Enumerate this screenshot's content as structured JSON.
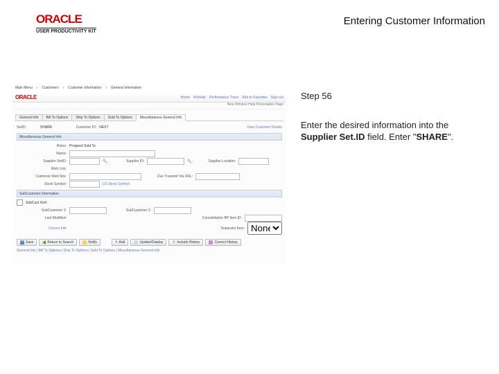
{
  "header": {
    "logo_main": "ORACLE",
    "logo_sub": "USER PRODUCTIVITY KIT",
    "page_title": "Entering Customer Information"
  },
  "instruction": {
    "step": "Step 56",
    "text_1": "Enter the desired information into the ",
    "field": "Supplier Set.ID",
    "text_2": " field. Enter \"",
    "value": "SHARE",
    "text_3": "\"."
  },
  "shot": {
    "breadcrumb": [
      "Main Menu",
      "Customers",
      "Customer Information",
      "General Information"
    ],
    "oracle": "ORACLE",
    "links": [
      "Home",
      "Worklist",
      "Performance Trace",
      "Add to Favorites",
      "Sign out"
    ],
    "subbar": "New Window   Help   Personalize Page",
    "tabs": [
      "General Info",
      "Bill To Options",
      "Ship To Options",
      "Sold To Options",
      "Miscellaneous General Info"
    ],
    "setid": {
      "label": "SetID:",
      "value": "SHARE"
    },
    "custid": {
      "label": "Customer ID:",
      "value": "NEXT"
    },
    "cust_details": "View Customer Details",
    "sect_misc": "Miscellaneous General Info",
    "roles": {
      "label": "Roles:",
      "value": "Prospect  Sold To"
    },
    "name": {
      "label": "Name:"
    },
    "supplier_setid": {
      "label": "Supplier SetID:"
    },
    "supplier_id": {
      "label": "Supplier ID:"
    },
    "supplier_loc": {
      "label": "Supplier Location:"
    },
    "weblink": {
      "label": "Web Link:"
    },
    "cust_website": {
      "label": "Customer Web Site:"
    },
    "dun_via": {
      "label": "Dun Transmit Via URL:"
    },
    "stock": {
      "label": "Stock Symbol:",
      "value": "US Stock Symbol"
    },
    "sect_sub": "SubCustomer Information",
    "subxref": "SubCust Xref:",
    "subc1": {
      "label": "SubCustomer 1:"
    },
    "subc2": {
      "label": "SubCustomer 2:"
    },
    "lastmod": {
      "label": "Last Modified:"
    },
    "consol_bp": {
      "label": "Consolidation BP Item ID:"
    },
    "correct_info": "Correct Info",
    "separator": {
      "label": "Separator Item:",
      "value": "None"
    },
    "buttons": {
      "save": "Save",
      "return": "Return to Search",
      "notify": "Notify",
      "add": "Add",
      "update": "Update/Display",
      "history": "Include History",
      "correct": "Correct History"
    },
    "crumb": "General Info | Bill To Options | Ship To Options | Sold To Options | Miscellaneous General Info"
  }
}
